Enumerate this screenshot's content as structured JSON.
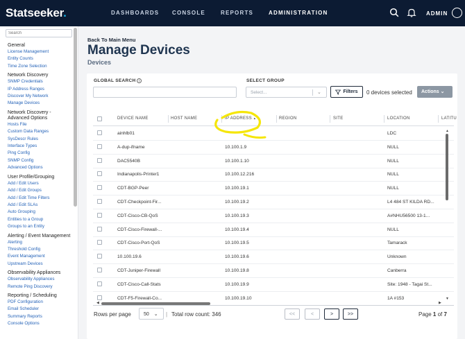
{
  "brand": {
    "name": "Statseeker",
    "dot": ".",
    "accent": "#19b3e6",
    "nav_bg": "#0c1b33"
  },
  "topnav": {
    "items": [
      "DASHBOARDS",
      "CONSOLE",
      "REPORTS",
      "ADMINISTRATION"
    ],
    "active": "ADMINISTRATION",
    "user": "ADMIN",
    "icons": [
      "search-icon",
      "bell-icon",
      "user-icon"
    ]
  },
  "sidebar": {
    "search_placeholder": "Search",
    "groups": [
      {
        "title": "General",
        "links": [
          "License Management",
          "Entity Counts",
          "Time Zone Selection"
        ]
      },
      {
        "title": "Network Discovery",
        "links": [
          "SNMP Credentials",
          "IP Address Ranges",
          "Discover My Network",
          "Manage Devices"
        ]
      },
      {
        "title": "Network Discovery - Advanced Options",
        "links": [
          "Hosts File",
          "Custom Data Ranges",
          "SysDescr Rules",
          "Interface Types",
          "Ping Config",
          "SNMP Config",
          "Advanced Options"
        ]
      },
      {
        "title": "User Profile/Grouping",
        "links": [
          "Add / Edit Users",
          "Add / Edit Groups",
          "Add / Edit Time Filters",
          "Add / Edit SLAs",
          "Auto Grouping",
          "Entities to a Group",
          "Groups to an Entity"
        ]
      },
      {
        "title": "Alerting / Event Management",
        "links": [
          "Alerting",
          "Threshold Config",
          "Event Management",
          "Upstream Devices"
        ]
      },
      {
        "title": "Observability Appliances",
        "links": [
          "Observability Appliances",
          "Remote Ping Discovery"
        ]
      },
      {
        "title": "Reporting / Scheduling",
        "links": [
          "PDF Configuration",
          "Email Scheduler",
          "Summary Reports",
          "Console Options"
        ]
      }
    ]
  },
  "header": {
    "back": "Back To Main Menu",
    "title": "Manage Devices",
    "subtitle": "Devices"
  },
  "filters": {
    "global_search_label": "GLOBAL SEARCH",
    "select_group_label": "SELECT GROUP",
    "select_placeholder": "Select...",
    "filters_button": "Filters",
    "selection_count": "0 devices selected",
    "actions_button": "Actions"
  },
  "table": {
    "columns": [
      "DEVICE NAME",
      "HOST NAME",
      "IP ADDRESS",
      "REGION",
      "SITE",
      "LOCATION",
      "LATITU"
    ],
    "sort_indicator": "▲",
    "rows": [
      [
        "ainhlb01",
        "",
        "",
        "",
        "",
        "LDC"
      ],
      [
        "A-dup-ifname",
        "",
        "10.100.1.9",
        "",
        "",
        "NULL"
      ],
      [
        "DAC5540B",
        "",
        "10.100.1.10",
        "",
        "",
        "NULL"
      ],
      [
        "Indianapolis-Printer1",
        "",
        "10.100.12.216",
        "",
        "",
        "NULL"
      ],
      [
        "CDT-BGP-Peer",
        "",
        "10.100.19.1",
        "",
        "",
        "NULL"
      ],
      [
        "CDT-Checkpoint-Fir...",
        "",
        "10.100.19.2",
        "",
        "",
        "L4 484 ST KILDA RD..."
      ],
      [
        "CDT-Cisco-CB-QoS",
        "",
        "10.100.19.3",
        "",
        "",
        "A#NHU56500 13-1..."
      ],
      [
        "CDT-Cisco-Firewall-...",
        "",
        "10.100.19.4",
        "",
        "",
        "NULL"
      ],
      [
        "CDT-Cisco-Port-QoS",
        "",
        "10.100.19.5",
        "",
        "",
        "Tamarack"
      ],
      [
        "10.100.19.6",
        "",
        "10.100.19.6",
        "",
        "",
        "Unknown"
      ],
      [
        "CDT-Juniper-Firewall",
        "",
        "10.100.19.8",
        "",
        "",
        "Canberra"
      ],
      [
        "CDT-Cisco-Call-Stats",
        "",
        "10.100.19.9",
        "",
        "",
        "Site: 1948 - Tagai St..."
      ],
      [
        "CDT-F5-Firewall-Co...",
        "",
        "10.100.19.10",
        "",
        "",
        "1A #153"
      ]
    ]
  },
  "pagination": {
    "rows_per_page_label": "Rows per page",
    "rows_per_page": "50",
    "separator": "|",
    "total": "Total row count: 346",
    "first": "<<",
    "prev": "<",
    "next": ">",
    "last": ">>",
    "page_label": "Page",
    "page": "1",
    "of_label": "of",
    "pages": "7"
  },
  "annotation": {
    "color": "#f5e60a"
  }
}
